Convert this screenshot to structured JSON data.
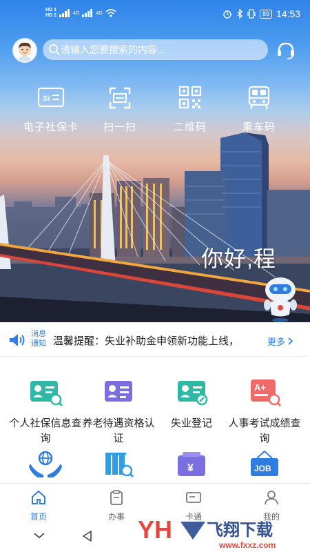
{
  "status": {
    "left": [
      "HD",
      "1",
      "HD",
      "2",
      "4G",
      "4G"
    ],
    "battery": "89",
    "time": "14:53"
  },
  "header": {
    "search_placeholder": "请输入您要搜索的内容..."
  },
  "quick_actions": [
    {
      "label": "电子社保卡",
      "icon": "social-security-card-icon"
    },
    {
      "label": "扫一扫",
      "icon": "scan-icon"
    },
    {
      "label": "二维码",
      "icon": "qr-code-icon"
    },
    {
      "label": "乘车码",
      "icon": "bus-code-icon"
    }
  ],
  "banner": {
    "greeting": "你好,程"
  },
  "notice": {
    "tag_line1": "消息",
    "tag_line2": "通知",
    "text": "温馨提醒：失业补助金申领新功能上线，",
    "more": "更多"
  },
  "services": [
    {
      "label": "个人社保信息查询",
      "icon": "social-insurance-query-icon",
      "color": "#2fb8a6"
    },
    {
      "label": "养老待遇资格认证",
      "icon": "pension-certification-icon",
      "color": "#7b6ee0"
    },
    {
      "label": "失业登记",
      "icon": "unemployment-registration-icon",
      "color": "#2fb8a6"
    },
    {
      "label": "人事考试成绩查询",
      "icon": "exam-score-query-icon",
      "color": "#f06a6a"
    },
    {
      "label": "",
      "icon": "global-hands-icon",
      "color": "#2f7de1"
    },
    {
      "label": "",
      "icon": "archive-search-icon",
      "color": "#2f9ee8"
    },
    {
      "label": "",
      "icon": "wallet-yuan-icon",
      "color": "#7b6ee0"
    },
    {
      "label": "",
      "icon": "job-sign-icon",
      "color": "#2f7de1"
    }
  ],
  "tabs": [
    {
      "label": "首页",
      "icon": "home-icon",
      "active": true
    },
    {
      "label": "办事",
      "icon": "affairs-icon",
      "active": false
    },
    {
      "label": "卡通",
      "icon": "card-icon",
      "active": false
    },
    {
      "label": "我的",
      "icon": "profile-icon",
      "active": false
    }
  ],
  "watermark": {
    "brand": "飞翔下载",
    "url": "www.fxxz.com"
  },
  "colors": {
    "accent": "#2f7de1",
    "teal": "#2fb8a6",
    "purple": "#7b6ee0",
    "red": "#f06a6a"
  }
}
